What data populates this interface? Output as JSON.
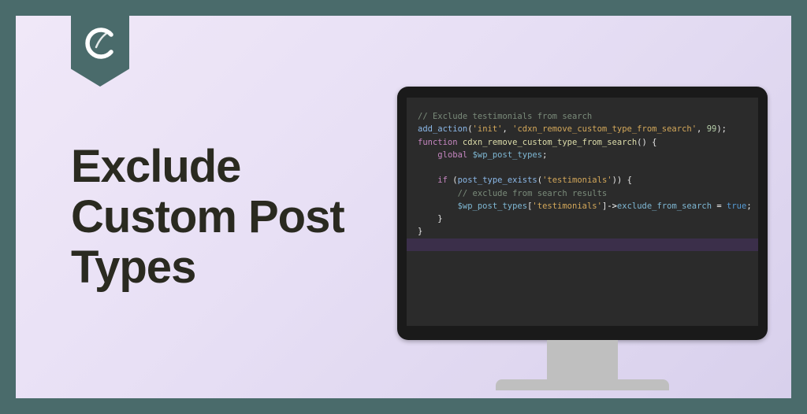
{
  "badge": {
    "icon": "logo-c-icon"
  },
  "title": "Exclude Custom Post Types",
  "code": {
    "comment1": "// Exclude testimonials from search",
    "fn_add_action": "add_action",
    "str_init": "'init'",
    "str_hook": "'cdxn_remove_custom_type_from_search'",
    "num_priority": "99",
    "kw_function": "function",
    "fn_name": "cdxn_remove_custom_type_from_search",
    "kw_global": "global",
    "var_types": "$wp_post_types",
    "kw_if": "if",
    "fn_exists": "post_type_exists",
    "str_test": "'testimonials'",
    "comment2": "// exclude from search results",
    "prop_exclude": "exclude_from_search",
    "kw_true": "true"
  }
}
